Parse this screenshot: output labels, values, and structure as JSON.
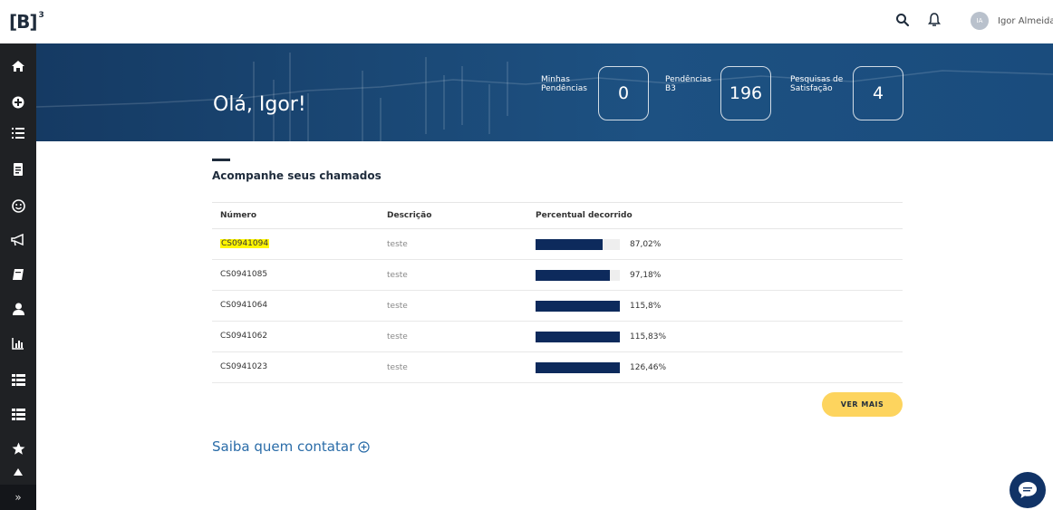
{
  "brand": {
    "logo_text": "[B]",
    "logo_sup": "3"
  },
  "header": {
    "user_initials": "IA",
    "user_name": "Igor Almeida*",
    "icons": [
      "search-icon",
      "bell-icon"
    ]
  },
  "sidebar": {
    "items": [
      "home-icon",
      "plus-circle-icon",
      "list-icon",
      "document-icon",
      "smile-icon",
      "megaphone-icon",
      "book-icon",
      "user-icon",
      "bar-chart-icon",
      "table-list-icon",
      "table-list-icon",
      "star-icon",
      "pin-icon"
    ],
    "expand_label": "»"
  },
  "banner": {
    "greeting": "Olá, Igor!",
    "stats": [
      {
        "label_line1": "Minhas",
        "label_line2": "Pendências",
        "value": "0"
      },
      {
        "label_line1": "Pendências",
        "label_line2": "B3",
        "value": "196"
      },
      {
        "label_line1": "Pesquisas de",
        "label_line2": "Satisfação",
        "value": "4"
      }
    ]
  },
  "main": {
    "section_title": "Acompanhe seus chamados",
    "columns": [
      "Número",
      "Descrição",
      "Percentual decorrido"
    ],
    "rows": [
      {
        "numero": "CS0941094",
        "descricao": "teste",
        "percent_label": "87,02%",
        "percent": 87.02,
        "highlighted": true
      },
      {
        "numero": "CS0941085",
        "descricao": "teste",
        "percent_label": "97,18%",
        "percent": 97.18,
        "highlighted": false
      },
      {
        "numero": "CS0941064",
        "descricao": "teste",
        "percent_label": "115,8%",
        "percent": 115.8,
        "highlighted": false
      },
      {
        "numero": "CS0941062",
        "descricao": "teste",
        "percent_label": "115,83%",
        "percent": 115.83,
        "highlighted": false
      },
      {
        "numero": "CS0941023",
        "descricao": "teste",
        "percent_label": "126,46%",
        "percent": 126.46,
        "highlighted": false
      }
    ],
    "ver_mais_label": "VER MAIS",
    "saiba_label": "Saiba quem contatar"
  },
  "colors": {
    "sidebar_bg": "#1f2124",
    "banner_bg": "#1b4a78",
    "bar_fill": "#0d2a5c",
    "button_yellow": "#fdd45e",
    "link_blue": "#2a6ca8",
    "highlight": "#fff600"
  }
}
